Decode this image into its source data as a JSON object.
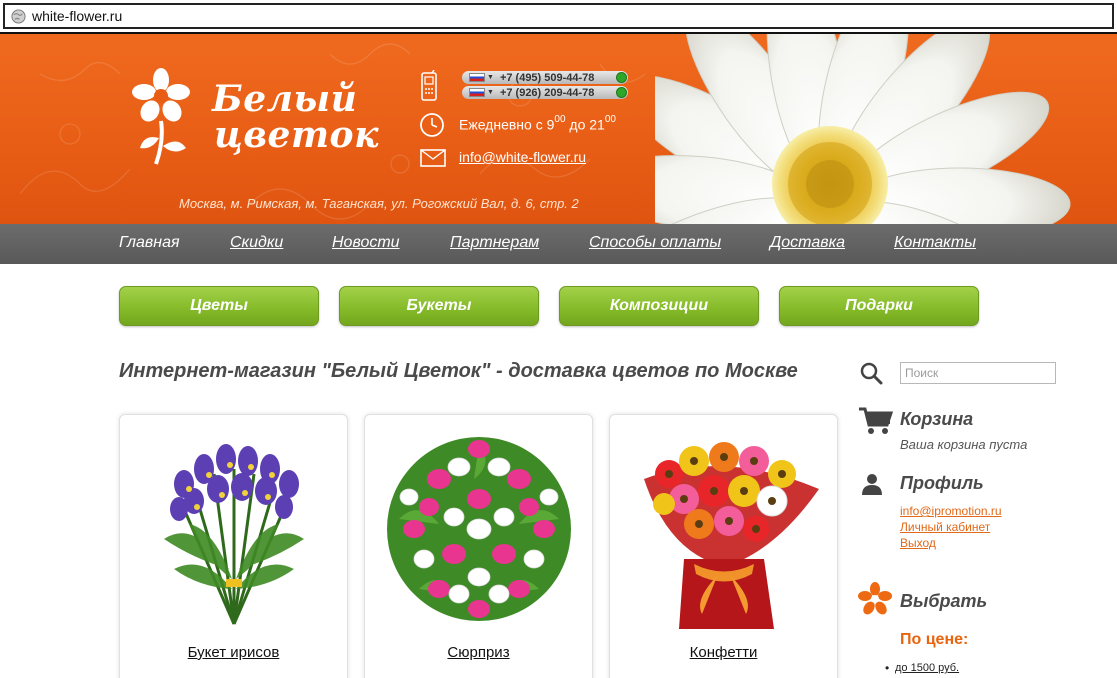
{
  "browser": {
    "url": "white-flower.ru"
  },
  "header": {
    "brand_line1": "Белый",
    "brand_line2": "цветок",
    "phone1": "+7 (495) 509-44-78",
    "phone2": "+7 (926) 209-44-78",
    "hours_prefix": "Ежедневно с 9",
    "hours_from_sup": "00",
    "hours_mid": " до 21",
    "hours_to_sup": "00",
    "email": "info@white-flower.ru",
    "address": "Москва, м. Римская, м. Таганская, ул. Рогожский Вал, д. 6, стр. 2"
  },
  "nav": [
    {
      "label": "Главная"
    },
    {
      "label": "Скидки"
    },
    {
      "label": "Новости"
    },
    {
      "label": "Партнерам"
    },
    {
      "label": "Способы оплаты"
    },
    {
      "label": "Доставка"
    },
    {
      "label": "Контакты"
    }
  ],
  "categories": [
    {
      "label": "Цветы"
    },
    {
      "label": "Букеты"
    },
    {
      "label": "Композиции"
    },
    {
      "label": "Подарки"
    }
  ],
  "page_title": "Интернет-магазин \"Белый Цветок\" - доставка цветов по Москве",
  "products": [
    {
      "name": "Букет ирисов"
    },
    {
      "name": "Сюрприз"
    },
    {
      "name": "Конфетти"
    }
  ],
  "sidebar": {
    "search_placeholder": "Поиск",
    "cart_title": "Корзина",
    "cart_status": "Ваша корзина пуста",
    "profile_title": "Профиль",
    "profile_email": "info@ipromotion.ru",
    "profile_cabinet": "Личный кабинет",
    "profile_logout": "Выход",
    "choose_title": "Выбрать",
    "price_title": "По цене:",
    "price_option": "до 1500 руб."
  },
  "colors": {
    "header_orange": "#e85d15",
    "nav_gray": "#606060",
    "button_green": "#86bc2a",
    "link_orange": "#e0691a"
  }
}
